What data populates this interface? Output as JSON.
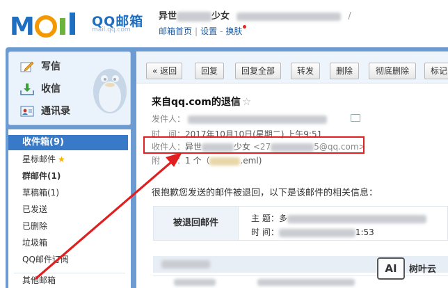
{
  "header": {
    "logo_text": "MOil",
    "product": "QQ邮箱",
    "user_prefix": "异世",
    "user_suffix": "少女",
    "caret": "/",
    "links": [
      "邮箱首页",
      "设置",
      "换肤"
    ]
  },
  "sidebar": {
    "quick": [
      {
        "label": "写信",
        "icon": "compose-icon"
      },
      {
        "label": "收信",
        "icon": "inbox-download-icon"
      },
      {
        "label": "通讯录",
        "icon": "contacts-icon"
      }
    ],
    "folders": [
      {
        "label": "收件箱(9)"
      },
      {
        "label": "星标邮件"
      },
      {
        "label": "群邮件(1)"
      },
      {
        "label": "草稿箱(1)"
      },
      {
        "label": "已发送"
      },
      {
        "label": "已删除"
      },
      {
        "label": "垃圾箱"
      },
      {
        "label": "QQ邮件订阅"
      },
      {
        "label": "其他邮箱"
      }
    ]
  },
  "toolbar": {
    "buttons": [
      "« 返回",
      "回复",
      "回复全部",
      "转发",
      "删除",
      "彻底删除",
      "标记"
    ]
  },
  "mail": {
    "subject": "来自qq.com的退信",
    "star": "☆",
    "sender_label": "发件人：",
    "time_label": "时　间：",
    "time_value": "2017年10月10日(星期二) 上午9:51",
    "recipient_label": "收件人：",
    "recipient_name_a": "异世",
    "recipient_name_b": "少女",
    "recipient_email_a": "<27",
    "recipient_email_b": "5@qq.com>",
    "attach_label": "附　件：",
    "attach_value": "1 个（",
    "attach_file": ".eml)",
    "body": "很抱歉您发送的邮件被退回，以下是该邮件的相关信息：",
    "bounce_label": "被退回邮件",
    "bounce_subject_label": "主 题：多",
    "bounce_time_label": "时 间：",
    "bounce_time_tail": "1:53"
  },
  "watermark": {
    "badge": "AI",
    "text": "树叶云"
  },
  "colors": {
    "brand_blue": "#1e6fc2",
    "frame_blue": "#6c9bd2",
    "active_folder": "#3879c8",
    "highlight_red": "#e02020"
  }
}
